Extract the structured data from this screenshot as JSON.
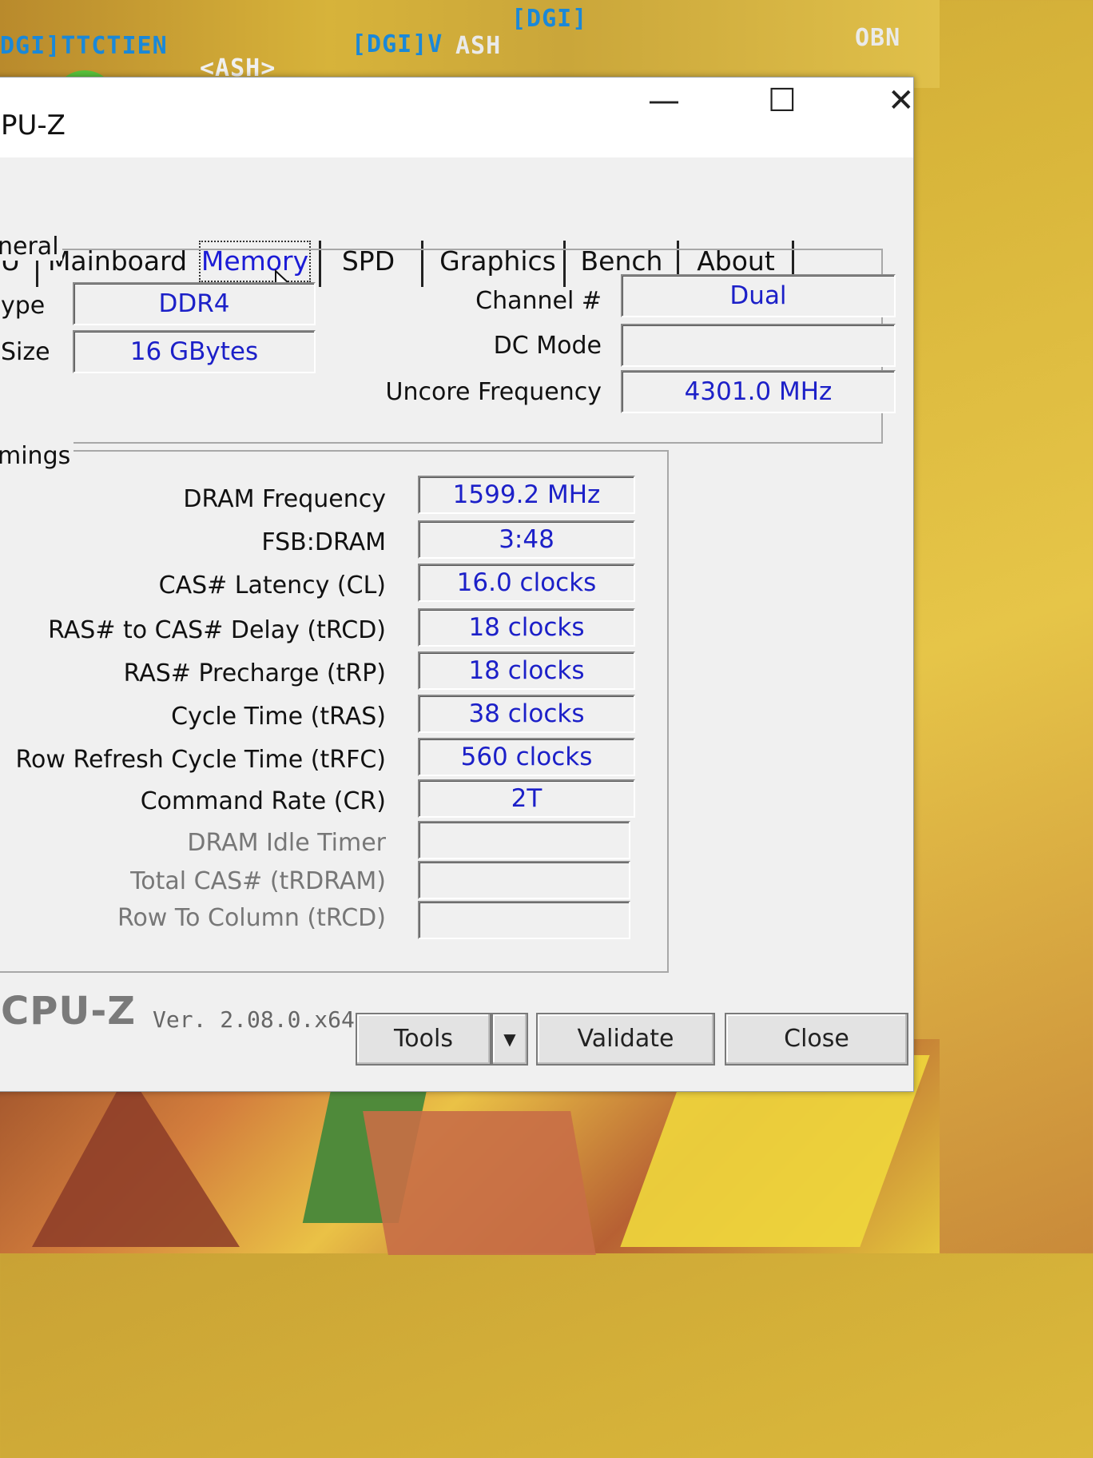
{
  "background": {
    "text_lines": [
      "DGI]TTCTIEN",
      "<ASH>",
      "[DGI]V",
      "ASH",
      "[DGI]",
      "OBN"
    ]
  },
  "window": {
    "title": "PU-Z",
    "controls": {
      "minimize": "—",
      "maximize": "☐",
      "close": "✕"
    }
  },
  "tabs": [
    {
      "label": "U"
    },
    {
      "label": "Mainboard"
    },
    {
      "label": "Memory",
      "active": true
    },
    {
      "label": "SPD"
    },
    {
      "label": "Graphics"
    },
    {
      "label": "Bench"
    },
    {
      "label": "About"
    }
  ],
  "general": {
    "legend": "neral",
    "type_label": "ype",
    "type_value": "DDR4",
    "size_label": "Size",
    "size_value": "16 GBytes",
    "channel_label": "Channel #",
    "channel_value": "Dual",
    "dc_mode_label": "DC Mode",
    "dc_mode_value": "",
    "uncore_label": "Uncore Frequency",
    "uncore_value": "4301.0 MHz"
  },
  "timings": {
    "legend": "mings",
    "rows": [
      {
        "label": "DRAM Frequency",
        "value": "1599.2 MHz"
      },
      {
        "label": "FSB:DRAM",
        "value": "3:48"
      },
      {
        "label": "CAS# Latency (CL)",
        "value": "16.0 clocks"
      },
      {
        "label": "RAS# to CAS# Delay (tRCD)",
        "value": "18 clocks"
      },
      {
        "label": "RAS# Precharge (tRP)",
        "value": "18 clocks"
      },
      {
        "label": "Cycle Time (tRAS)",
        "value": "38 clocks"
      },
      {
        "label": "Row Refresh Cycle Time (tRFC)",
        "value": "560 clocks"
      },
      {
        "label": "Command Rate (CR)",
        "value": "2T"
      },
      {
        "label": "DRAM Idle Timer",
        "value": ""
      },
      {
        "label": "Total CAS# (tRDRAM)",
        "value": ""
      },
      {
        "label": "Row To Column (tRCD)",
        "value": ""
      }
    ]
  },
  "footer": {
    "brand": "CPU-Z",
    "version": "Ver. 2.08.0.x64",
    "tools_label": "Tools",
    "tools_arrow": "▼",
    "validate_label": "Validate",
    "close_label": "Close"
  },
  "colors": {
    "value_text": "#1c20c8",
    "window_bg": "#f0f0f0"
  }
}
